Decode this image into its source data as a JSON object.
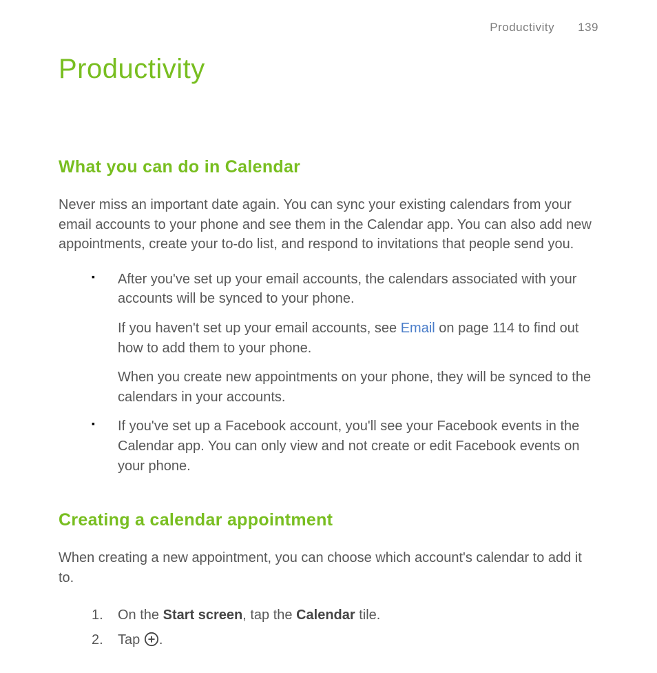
{
  "header": {
    "section": "Productivity",
    "page_number": "139"
  },
  "title": "Productivity",
  "section1": {
    "heading": "What you can do in Calendar",
    "intro": "Never miss an important date again. You can sync your existing calendars from your email accounts to your phone and see them in the Calendar app. You can also add new appointments, create your to-do list, and respond to invitations that people send you.",
    "bullets": {
      "b1_p1": "After you've set up your email accounts, the calendars associated with your accounts will be synced to your phone.",
      "b1_p2_before": "If you haven't set up your email accounts, see ",
      "b1_p2_link": "Email",
      "b1_p2_after": " on page 114 to find out how to add them to your phone.",
      "b1_p3": "When you create new appointments on your phone, they will be synced to the calendars in your accounts.",
      "b2_p1": "If you've set up a Facebook account, you'll see your Facebook events in the Calendar app. You can only view and not create or edit Facebook events on your phone."
    }
  },
  "section2": {
    "heading": "Creating a calendar appointment",
    "intro": "When creating a new appointment, you can choose which account's calendar to add it to.",
    "steps": {
      "s1_before": "On the ",
      "s1_strong1": "Start screen",
      "s1_mid": ", tap the ",
      "s1_strong2": "Calendar",
      "s1_after": " tile.",
      "s2_before": "Tap ",
      "s2_after": "."
    }
  },
  "icons": {
    "plus": "plus-circle-icon"
  }
}
